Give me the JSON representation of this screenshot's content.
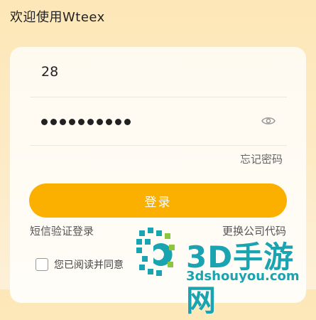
{
  "header": {
    "welcome": "欢迎使用Wteex"
  },
  "form": {
    "account_value": "28",
    "password_mask_length": 10,
    "forgot_password": "忘记密码",
    "login_button": "登录",
    "sms_login": "短信验证登录",
    "change_company": "更换公司代码",
    "agreement_text": "您已阅读并同意"
  },
  "watermark": {
    "brand": "3D手游网",
    "url": "3dshouyou.com"
  },
  "colors": {
    "accent": "#fbb000",
    "watermark": "#1aa3b0"
  },
  "icons": [
    "eye-icon",
    "checkbox-icon"
  ]
}
